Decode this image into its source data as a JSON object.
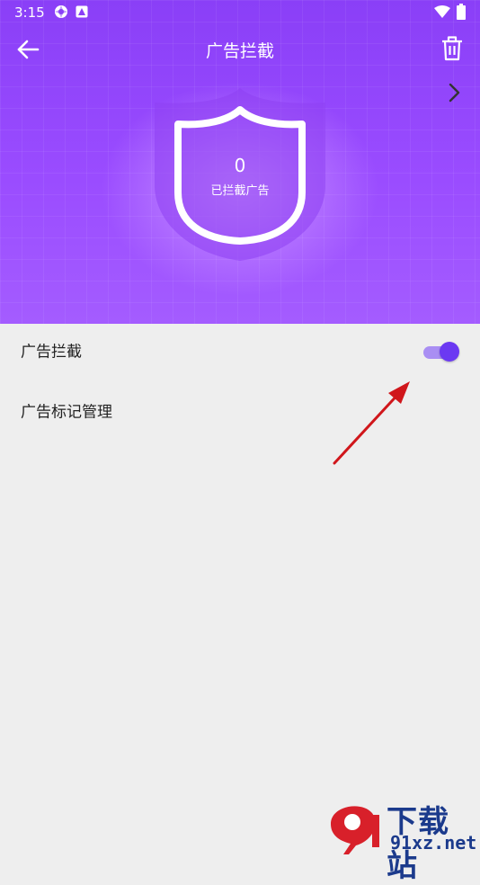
{
  "status_bar": {
    "time": "3:15"
  },
  "header": {
    "title": "广告拦截"
  },
  "hero": {
    "count": "0",
    "count_label": "已拦截广告"
  },
  "settings": {
    "rows": [
      {
        "label": "广告拦截",
        "toggle_on": true
      },
      {
        "label": "广告标记管理"
      }
    ]
  },
  "colors": {
    "primary": "#8a3ff7",
    "toggle_thumb": "#6b39f2",
    "toggle_track": "#a98ef3",
    "background": "#eeeeee",
    "annotation_arrow": "#d0161b"
  },
  "icons": {
    "back": "arrow-left-icon",
    "delete": "trash-icon",
    "shield": "shield-icon",
    "chevron": "chevron-right-icon"
  },
  "watermark": {
    "brand": "下载站",
    "url": "91xz.net"
  }
}
